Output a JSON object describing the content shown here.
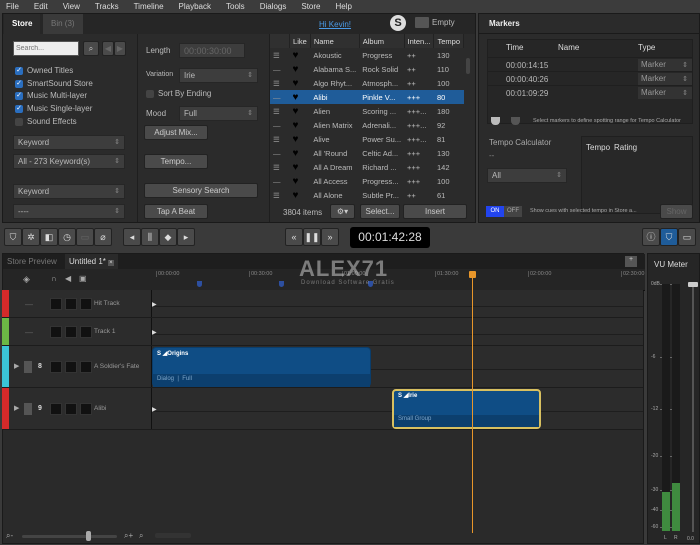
{
  "menu": [
    "File",
    "Edit",
    "View",
    "Tracks",
    "Timeline",
    "Playback",
    "Tools",
    "Dialogs",
    "Store",
    "Help"
  ],
  "store": {
    "tabs": [
      "Store",
      "Bin (3)"
    ],
    "greeting": "Hi Kevin!",
    "cart": "Empty",
    "search_placeholder": "Search...",
    "filters": [
      {
        "label": "Owned Titles",
        "checked": true
      },
      {
        "label": "SmartSound Store",
        "checked": true
      },
      {
        "label": "Music Multi-layer",
        "checked": true
      },
      {
        "label": "Music Single-layer",
        "checked": true
      },
      {
        "label": "Sound Effects",
        "checked": false
      }
    ],
    "keyword1": "Keyword",
    "keyword1_value": "All - 273 Keyword(s)",
    "keyword2": "Keyword",
    "keyword2_value": "----",
    "length_label": "Length",
    "length_value": "00:00:30:00",
    "variation_label": "Variation",
    "variation_value": "Irie",
    "sort_by_ending": "Sort By Ending",
    "mood_label": "Mood",
    "mood_value": "Full",
    "adjust_mix": "Adjust Mix...",
    "tempo": "Tempo...",
    "sensory_search": "Sensory Search",
    "tap_a_beat": "Tap A Beat",
    "columns": [
      "Like",
      "Name",
      "Album",
      "Inten...",
      "Tempo"
    ],
    "rows": [
      {
        "name": "Akoustic",
        "album": "Progress",
        "intensity": "++",
        "tempo": "130"
      },
      {
        "name": "Alabama S...",
        "album": "Rock Solid",
        "intensity": "++",
        "tempo": "110"
      },
      {
        "name": "Algo Rhyt...",
        "album": "Atmosph...",
        "intensity": "++",
        "tempo": "100"
      },
      {
        "name": "Alibi",
        "album": "Pinkle V...",
        "intensity": "+++",
        "tempo": "80",
        "selected": true
      },
      {
        "name": "Alien",
        "album": "Scoring ...",
        "intensity": "+++...",
        "tempo": "180"
      },
      {
        "name": "Alien Matrix",
        "album": "Adrenali...",
        "intensity": "+++...",
        "tempo": "92"
      },
      {
        "name": "Alive",
        "album": "Power Su...",
        "intensity": "+++...",
        "tempo": "81"
      },
      {
        "name": "All 'Round",
        "album": "Celtic Ad...",
        "intensity": "+++",
        "tempo": "130"
      },
      {
        "name": "All A Dream",
        "album": "Richard ...",
        "intensity": "+++",
        "tempo": "142"
      },
      {
        "name": "All Access",
        "album": "Progress...",
        "intensity": "+++",
        "tempo": "100"
      },
      {
        "name": "All Alone",
        "album": "Subtle Pr...",
        "intensity": "++",
        "tempo": "61"
      }
    ],
    "item_count": "3804 items",
    "select": "Select...",
    "insert": "Insert"
  },
  "markers": {
    "title": "Markers",
    "columns": [
      "Time",
      "Name",
      "Type"
    ],
    "rows": [
      {
        "time": "00:00:14:15",
        "name": "",
        "type": "Marker"
      },
      {
        "time": "00:00:40:26",
        "name": "",
        "type": "Marker"
      },
      {
        "time": "00:01:09:29",
        "name": "",
        "type": "Marker"
      }
    ],
    "hint": "Select markers to define spotting range for Tempo Calculator",
    "tempo_calc": "Tempo Calculator",
    "tempo_calc_value": "--",
    "filter": "All",
    "result_columns": [
      "Tempo",
      "Rating"
    ],
    "on": "ON",
    "off": "OFF",
    "show_hint": "Show cues with selected tempo in Store a...",
    "show": "Show"
  },
  "transport": {
    "time": "00:01:42:28"
  },
  "timeline": {
    "tabs": [
      "Store Preview",
      "Untitled 1*"
    ],
    "ruler": [
      "00:00:00",
      "00:30:00",
      "01:00:00",
      "01:30:00",
      "02:00:00",
      "02:30:00"
    ],
    "tracks": [
      {
        "num": "",
        "name": "Hit Track",
        "color": "#d42a2a"
      },
      {
        "num": "",
        "name": "Track 1",
        "color": "#6cb845"
      },
      {
        "num": "8",
        "name": "A Soldier's Fate",
        "color": "#3bc4d6"
      },
      {
        "num": "9",
        "name": "Alibi",
        "color": "#d42a2a"
      }
    ],
    "clips": [
      {
        "title": "Origins",
        "layers": [
          "Dialog",
          "Full"
        ]
      },
      {
        "title": "Irie",
        "layers": [
          "Small Group"
        ]
      }
    ],
    "watermark": "ALEX71",
    "watermark_sub": "Download Software Gratis"
  },
  "vu": {
    "title": "VU Meter",
    "ticks": [
      "0dB",
      "-6",
      "-12",
      "-20",
      "-30",
      "-40",
      "-60"
    ],
    "channels": [
      "L",
      "R"
    ],
    "gain": "0.0",
    "levels_db": [
      -31,
      -28
    ]
  },
  "colors": {
    "accent": "#1f5c99",
    "playhead": "#e8962a",
    "clip": "#0f4d85"
  }
}
